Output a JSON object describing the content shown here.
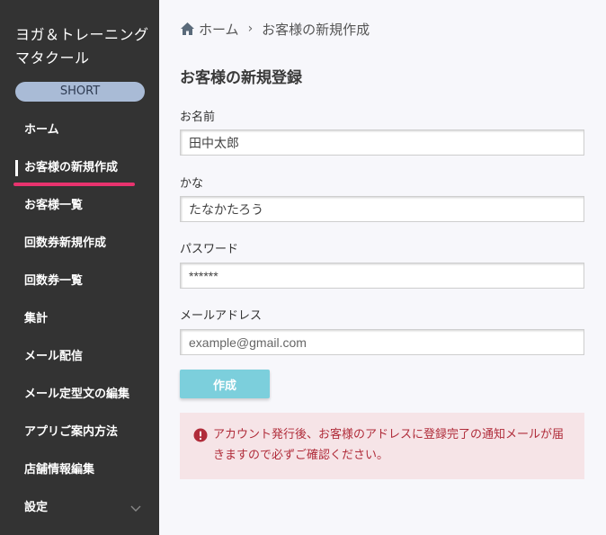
{
  "sidebar": {
    "brand": "ヨガ＆トレーニングマタクール",
    "plan_badge": "SHORT",
    "items": [
      {
        "label": "ホーム"
      },
      {
        "label": "お客様の新規作成"
      },
      {
        "label": "お客様一覧"
      },
      {
        "label": "回数券新規作成"
      },
      {
        "label": "回数券一覧"
      },
      {
        "label": "集計"
      },
      {
        "label": "メール配信"
      },
      {
        "label": "メール定型文の編集"
      },
      {
        "label": "アプリご案内方法"
      },
      {
        "label": "店舗情報編集"
      },
      {
        "label": "設定"
      }
    ],
    "active_index": 1
  },
  "breadcrumb": {
    "home": "ホーム",
    "separator": "›",
    "current": "お客様の新規作成"
  },
  "form": {
    "title": "お客様の新規登録",
    "name_label": "お名前",
    "name_value": "田中太郎",
    "kana_label": "かな",
    "kana_value": "たなかたろう",
    "password_label": "パスワード",
    "password_value": "******",
    "email_label": "メールアドレス",
    "email_placeholder": "example@gmail.com",
    "submit_label": "作成"
  },
  "notice": {
    "text": "アカウント発行後、お客様のアドレスに登録完了の通知メールが届きますので必ずご確認ください。"
  },
  "colors": {
    "sidebar_bg": "#333333",
    "accent_pink": "#e8336e",
    "badge_bg": "#a9bbd6",
    "button_bg": "#7ccfdc",
    "notice_bg": "#f6e4e7",
    "notice_text": "#b02c3a"
  }
}
